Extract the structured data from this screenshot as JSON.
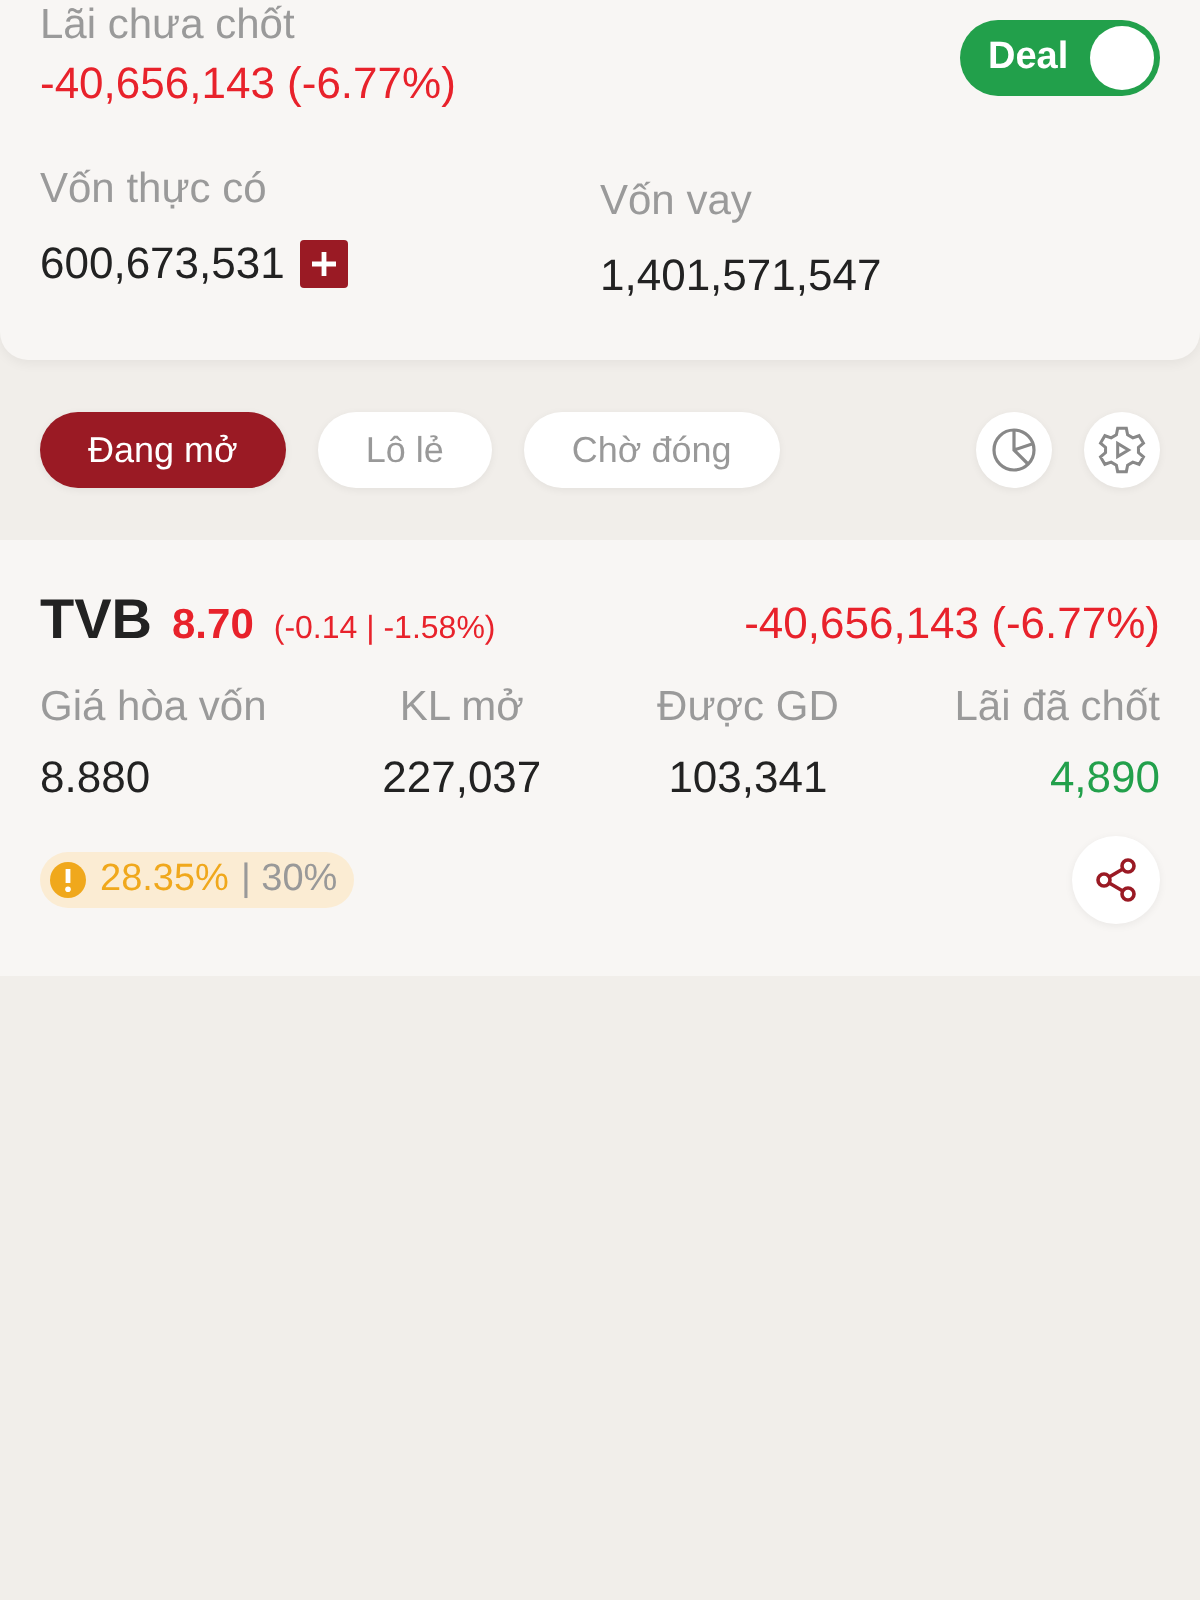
{
  "summary": {
    "pnl_label": "Lãi chưa chốt",
    "pnl_value": "-40,656,143 (-6.77%)",
    "deal_toggle": {
      "label": "Deal",
      "on": true
    },
    "equity_label": "Vốn thực có",
    "equity_value": "600,673,531",
    "loan_label": "Vốn vay",
    "loan_value": "1,401,571,547"
  },
  "tabs": [
    {
      "label": "Đang mở",
      "selected": true
    },
    {
      "label": "Lô lẻ",
      "selected": false
    },
    {
      "label": "Chờ đóng",
      "selected": false
    }
  ],
  "position": {
    "symbol": "TVB",
    "price": "8.70",
    "change": "(-0.14 | -1.58%)",
    "pnl": "-40,656,143 (-6.77%)",
    "stats": [
      {
        "label": "Giá hòa vốn",
        "value": "8.880",
        "color": "#222222"
      },
      {
        "label": "KL mở",
        "value": "227,037",
        "color": "#222222"
      },
      {
        "label": "Được GD",
        "value": "103,341",
        "color": "#222222"
      },
      {
        "label": "Lãi đã chốt",
        "value": "4,890",
        "color": "#22a04b"
      }
    ],
    "ratio": "28.35%",
    "ratio_limit": "| 30%"
  }
}
